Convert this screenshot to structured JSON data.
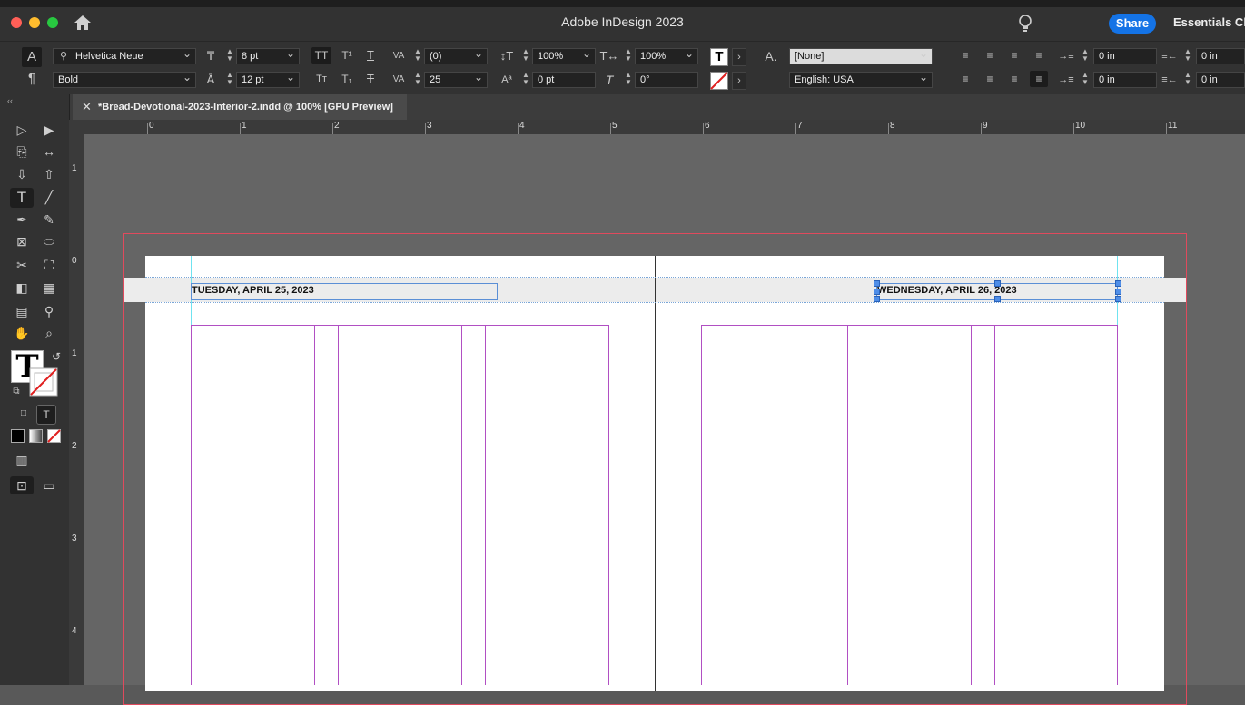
{
  "app": {
    "title": "Adobe InDesign 2023",
    "share_label": "Share",
    "workspace_label": "Essentials Cl"
  },
  "control_panel": {
    "font_family": "Helvetica Neue",
    "font_style": "Bold",
    "font_size": "8 pt",
    "leading": "12 pt",
    "kerning": "(0)",
    "tracking": "25",
    "vertical_scale": "100%",
    "horizontal_scale": "100%",
    "baseline_shift": "0 pt",
    "skew": "0°",
    "character_style": "[None]",
    "language": "English: USA",
    "left_indent": "0 in",
    "right_indent": "0 in",
    "first_line_indent": "0 in",
    "last_line_indent": "0 in",
    "character_mode_icon": "A",
    "paragraph_mode_icon": "¶",
    "colors": {
      "fill": "#000000",
      "stroke": "none"
    }
  },
  "document_tab": {
    "label": "*Bread-Devotional-2023-Interior-2.indd @ 100% [GPU Preview]"
  },
  "rulers": {
    "horizontal": [
      "0",
      "1",
      "2",
      "3",
      "4",
      "5",
      "6",
      "7",
      "8",
      "9",
      "10",
      "11"
    ],
    "vertical": [
      "1",
      "0",
      "1",
      "2",
      "3",
      "4"
    ]
  },
  "pages": {
    "left_header": "TUESDAY, APRIL 25, 2023",
    "right_header": "WEDNESDAY, APRIL 26, 2023"
  },
  "tools": [
    "selection-tool",
    "direct-selection-tool",
    "page-tool",
    "gap-tool",
    "content-collector-tool",
    "content-placer-tool",
    "type-tool",
    "line-tool",
    "pen-tool",
    "pencil-tool",
    "rectangle-frame-tool",
    "ellipse-tool",
    "scissors-tool",
    "free-transform-tool",
    "gradient-swatch-tool",
    "gradient-feather-tool",
    "note-tool",
    "eyedropper-tool",
    "hand-tool",
    "zoom-tool"
  ],
  "accent_colors": {
    "share": "#1473e6",
    "bleed": "#e04a5d",
    "column_guides": "#b14fc3",
    "frame": "#5b8fd6"
  }
}
